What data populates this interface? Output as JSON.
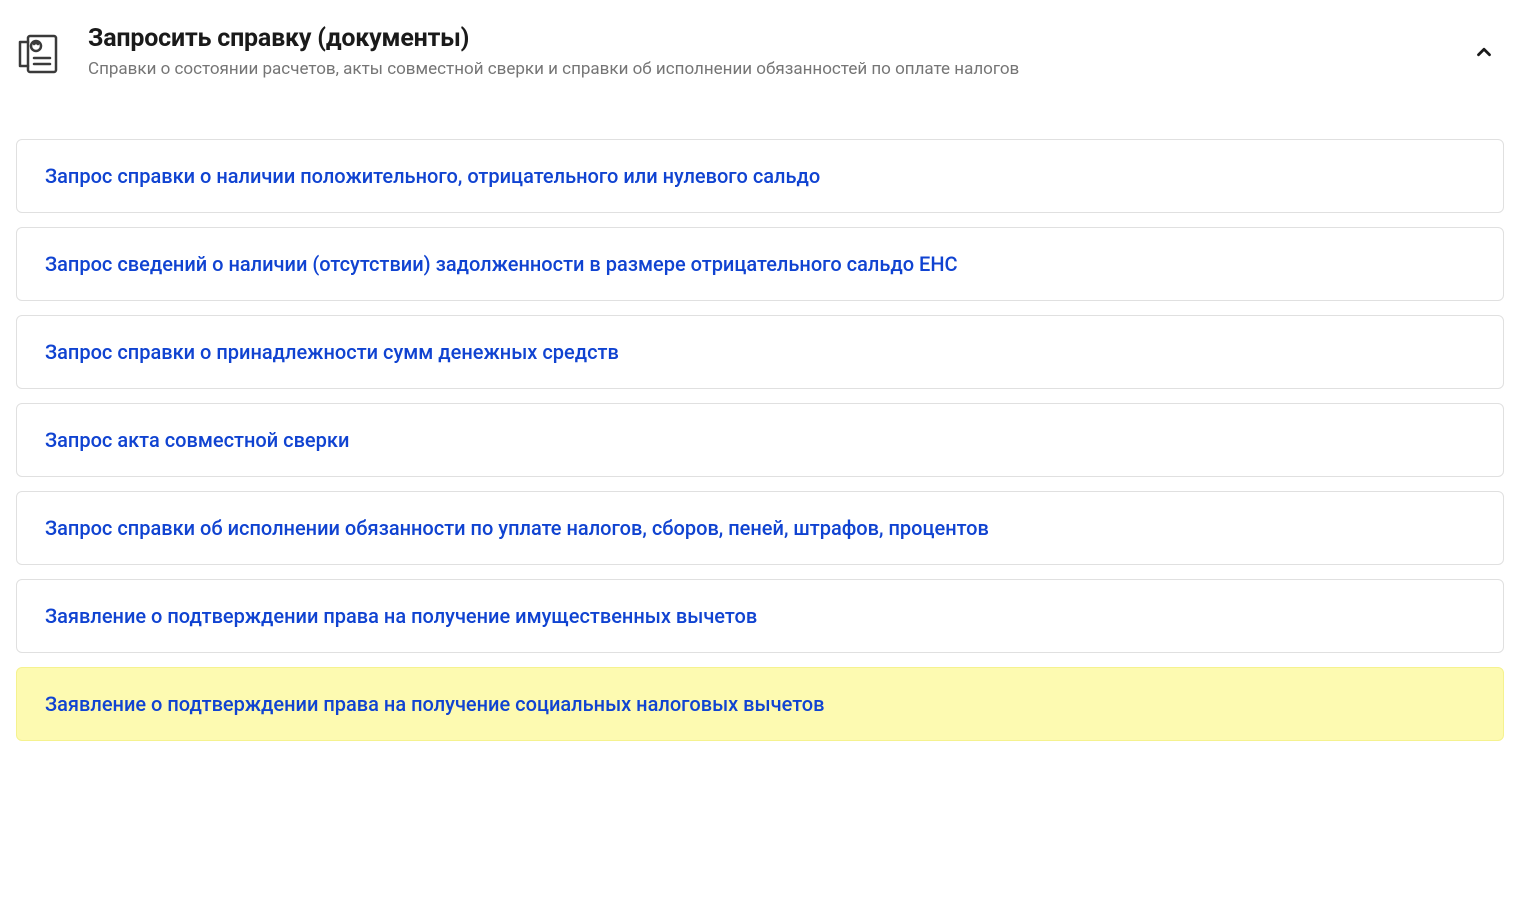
{
  "header": {
    "title": "Запросить справку (документы)",
    "subtitle": "Справки о состоянии расчетов, акты совместной сверки и справки об исполнении обязанностей по оплате налогов"
  },
  "items": [
    {
      "label": "Запрос справки о наличии положительного, отрицательного или нулевого сальдо",
      "highlighted": false
    },
    {
      "label": "Запрос сведений о наличии (отсутствии) задолженности в размере отрицательного сальдо ЕНС",
      "highlighted": false
    },
    {
      "label": "Запрос справки о принадлежности сумм денежных средств",
      "highlighted": false
    },
    {
      "label": "Запрос акта совместной сверки",
      "highlighted": false
    },
    {
      "label": "Запрос справки об исполнении обязанности по уплате налогов, сборов, пеней, штрафов, процентов",
      "highlighted": false
    },
    {
      "label": "Заявление о подтверждении права на получение имущественных вычетов",
      "highlighted": false
    },
    {
      "label": "Заявление о подтверждении права на получение социальных налоговых вычетов",
      "highlighted": true
    }
  ]
}
